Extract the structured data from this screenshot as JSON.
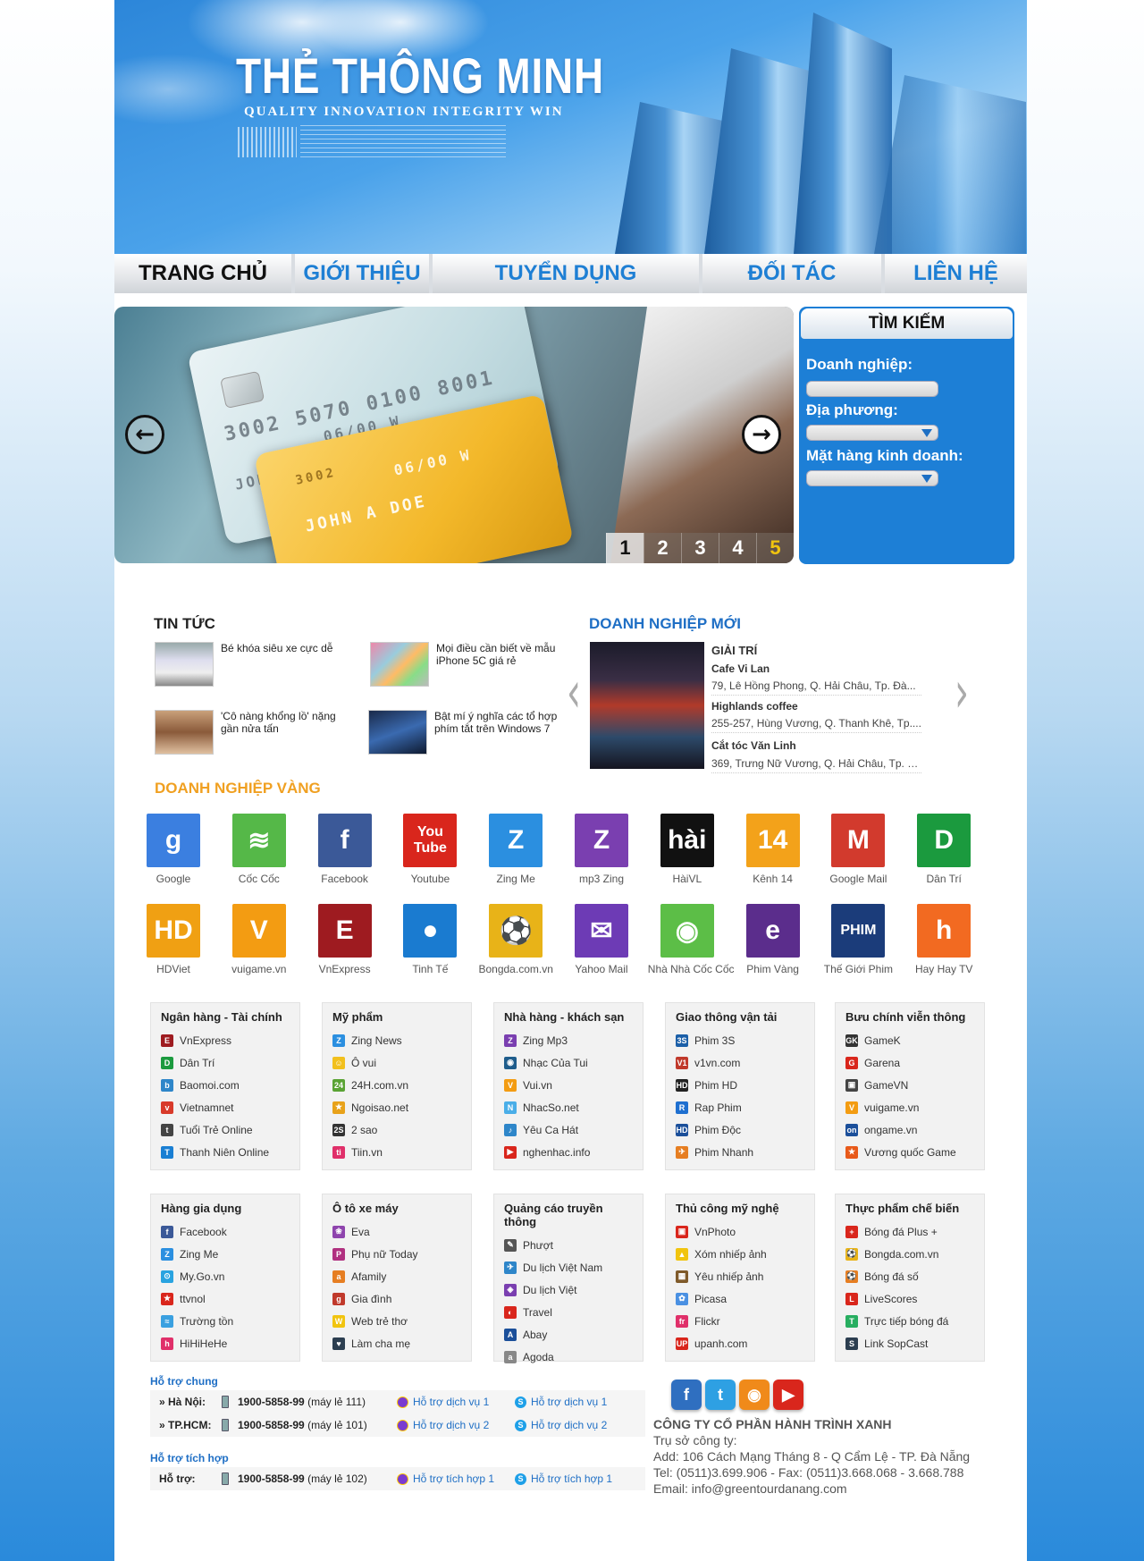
{
  "header": {
    "brand": "THẺ THÔNG MINH",
    "slogan": "QUALITY INNOVATION INTEGRITY WIN"
  },
  "nav": [
    {
      "label": "TRANG CHỦ",
      "active": true
    },
    {
      "label": "GIỚI THIỆU",
      "active": false
    },
    {
      "label": "TUYỂN DỤNG",
      "active": false
    },
    {
      "label": "ĐỐI TÁC",
      "active": false
    },
    {
      "label": "LIÊN HỆ",
      "active": false
    }
  ],
  "slider": {
    "card_number_1": "3002 5070 0100 8001",
    "card_date_1": "06/00 W",
    "card_name_1": "JOHN A DOE",
    "card_number_2": "3002",
    "card_date_2": "06/00 W",
    "card_name_2": "JOHN A DOE",
    "pages": [
      "1",
      "2",
      "3",
      "4",
      "5"
    ],
    "active_page": "1",
    "prev_icon": "arrow-left-icon",
    "next_icon": "arrow-right-icon"
  },
  "search": {
    "title": "TÌM KIẾM",
    "enterprise_label": "Doanh nghiệp:",
    "enterprise_value": "",
    "location_label": "Địa phương:",
    "location_value": "",
    "business_label": "Mặt hàng kinh doanh:",
    "business_value": ""
  },
  "news": {
    "title": "TIN TỨC",
    "items": [
      {
        "text": "Bé khóa siêu xe cực dễ"
      },
      {
        "text": "Mọi điều cần biết về mẫu iPhone 5C giá rẻ"
      },
      {
        "text": "'Cô nàng khổng lồ' nặng gần nửa tấn"
      },
      {
        "text": "Bật mí ý nghĩa các tổ hợp phím tắt trên Windows 7"
      }
    ]
  },
  "new_business": {
    "title": "DOANH NGHIỆP MỚI",
    "category": "GIẢI TRÍ",
    "items": [
      {
        "name": "Cafe Vi Lan",
        "address": "79, Lê Hồng Phong, Q. Hải Châu, Tp. Đà..."
      },
      {
        "name": "Highlands coffee",
        "address": "255-257, Hùng Vương, Q. Thanh Khê, Tp...."
      },
      {
        "name": "Cắt tóc Văn Linh",
        "address": "369, Trưng Nữ Vương, Q. Hải Châu, Tp. Đ..."
      }
    ]
  },
  "gold_business": {
    "title": "DOANH NGHIỆP VÀNG",
    "items": [
      {
        "label": "Google",
        "glyph": "g",
        "color": "#3b7fe0"
      },
      {
        "label": "Cốc Cốc",
        "glyph": "≋",
        "color": "#55b848"
      },
      {
        "label": "Facebook",
        "glyph": "f",
        "color": "#3b5998"
      },
      {
        "label": "Youtube",
        "glyph": "You Tube",
        "color": "#d9261c"
      },
      {
        "label": "Zing Me",
        "glyph": "Z",
        "color": "#2b8fe0"
      },
      {
        "label": "mp3 Zing",
        "glyph": "Z",
        "color": "#7a3fb0"
      },
      {
        "label": "HàiVL",
        "glyph": "hài",
        "color": "#111111"
      },
      {
        "label": "Kênh 14",
        "glyph": "14",
        "color": "#f3a21a"
      },
      {
        "label": "Google Mail",
        "glyph": "M",
        "color": "#d23a2d"
      },
      {
        "label": "Dân Trí",
        "glyph": "D",
        "color": "#1b9a3e"
      },
      {
        "label": "HDViet",
        "glyph": "HD",
        "color": "#f0a013"
      },
      {
        "label": "vuigame.vn",
        "glyph": "V",
        "color": "#f39c12"
      },
      {
        "label": "VnExpress",
        "glyph": "E",
        "color": "#9e1b20"
      },
      {
        "label": "Tinh Tế",
        "glyph": "●",
        "color": "#1a7bd0"
      },
      {
        "label": "Bongda.com.vn",
        "glyph": "⚽",
        "color": "#e8b318"
      },
      {
        "label": "Yahoo Mail",
        "glyph": "✉",
        "color": "#6d3bb5"
      },
      {
        "label": "Nhà Nhà Cốc Cốc",
        "glyph": "◉",
        "color": "#5cbe47"
      },
      {
        "label": "Phim Vàng",
        "glyph": "e",
        "color": "#5b2d8c"
      },
      {
        "label": "Thế Giới Phim",
        "glyph": "PHIM",
        "color": "#1b3c7a"
      },
      {
        "label": "Hay Hay TV",
        "glyph": "h",
        "color": "#f26a21"
      }
    ]
  },
  "categories": [
    {
      "title": "Ngân hàng - Tài chính",
      "links": [
        {
          "label": "VnExpress",
          "color": "#9e1b20",
          "g": "E"
        },
        {
          "label": "Dân Trí",
          "color": "#1b9a3e",
          "g": "D"
        },
        {
          "label": "Baomoi.com",
          "color": "#2e86c9",
          "g": "b"
        },
        {
          "label": "Vietnamnet",
          "color": "#d83a2a",
          "g": "v"
        },
        {
          "label": "Tuổi Trẻ Online",
          "color": "#444444",
          "g": "t"
        },
        {
          "label": "Thanh Niên Online",
          "color": "#1a7fd3",
          "g": "T"
        }
      ]
    },
    {
      "title": "Mỹ phẩm",
      "links": [
        {
          "label": "Zing News",
          "color": "#2b8fe0",
          "g": "Z"
        },
        {
          "label": "Ô vui",
          "color": "#f2c01d",
          "g": "☺"
        },
        {
          "label": "24H.com.vn",
          "color": "#5aa334",
          "g": "24"
        },
        {
          "label": "Ngoisao.net",
          "color": "#e8a21a",
          "g": "★"
        },
        {
          "label": "2 sao",
          "color": "#333333",
          "g": "2S"
        },
        {
          "label": "Tiin.vn",
          "color": "#e0306a",
          "g": "ti"
        }
      ]
    },
    {
      "title": "Nhà hàng - khách sạn",
      "links": [
        {
          "label": "Zing Mp3",
          "color": "#7a3fb0",
          "g": "Z"
        },
        {
          "label": "Nhạc Của Tui",
          "color": "#1f5d8c",
          "g": "◉"
        },
        {
          "label": "Vui.vn",
          "color": "#f39c12",
          "g": "V"
        },
        {
          "label": "NhacSo.net",
          "color": "#4aaee8",
          "g": "N"
        },
        {
          "label": "Yêu Ca Hát",
          "color": "#2e86c9",
          "g": "♪"
        },
        {
          "label": "nghenhac.info",
          "color": "#d9261c",
          "g": "▶"
        }
      ]
    },
    {
      "title": "Giao thông vận tải",
      "links": [
        {
          "label": "Phim 3S",
          "color": "#1b5fa8",
          "g": "3S"
        },
        {
          "label": "v1vn.com",
          "color": "#c0392b",
          "g": "V1"
        },
        {
          "label": "Phim HD",
          "color": "#222222",
          "g": "HD"
        },
        {
          "label": "Rap Phim",
          "color": "#1e6fd0",
          "g": "R"
        },
        {
          "label": "Phim Độc",
          "color": "#1b4f9a",
          "g": "HD"
        },
        {
          "label": "Phim Nhanh",
          "color": "#e67e22",
          "g": "✈"
        }
      ]
    },
    {
      "title": "Bưu chính viễn thông",
      "links": [
        {
          "label": "GameK",
          "color": "#333333",
          "g": "GK"
        },
        {
          "label": "Garena",
          "color": "#d9261c",
          "g": "G"
        },
        {
          "label": "GameVN",
          "color": "#444444",
          "g": "▣"
        },
        {
          "label": "vuigame.vn",
          "color": "#f39c12",
          "g": "V"
        },
        {
          "label": "ongame.vn",
          "color": "#1b4f9a",
          "g": "on"
        },
        {
          "label": "Vương quốc Game",
          "color": "#e85a1a",
          "g": "★"
        }
      ]
    },
    {
      "title": "Hàng gia dụng",
      "links": [
        {
          "label": "Facebook",
          "color": "#3b5998",
          "g": "f"
        },
        {
          "label": "Zing Me",
          "color": "#2b8fe0",
          "g": "Z"
        },
        {
          "label": "My.Go.vn",
          "color": "#29a3e0",
          "g": "⊙"
        },
        {
          "label": "ttvnol",
          "color": "#d9261c",
          "g": "★"
        },
        {
          "label": "Trường tồn",
          "color": "#3aa0e0",
          "g": "≈"
        },
        {
          "label": "HiHiHeHe",
          "color": "#e0306a",
          "g": "h"
        }
      ]
    },
    {
      "title": "Ô tô xe máy",
      "links": [
        {
          "label": "Eva",
          "color": "#8e44ad",
          "g": "❀"
        },
        {
          "label": "Phụ nữ Today",
          "color": "#b03080",
          "g": "P"
        },
        {
          "label": "Afamily",
          "color": "#e67e22",
          "g": "a"
        },
        {
          "label": "Gia đình",
          "color": "#c0392b",
          "g": "g"
        },
        {
          "label": "Web trẻ thơ",
          "color": "#f1c40f",
          "g": "W"
        },
        {
          "label": "Làm cha mẹ",
          "color": "#2c3e50",
          "g": "♥"
        }
      ]
    },
    {
      "title": "Quảng cáo truyền thông",
      "links": [
        {
          "label": "Phượt",
          "color": "#555555",
          "g": "✎"
        },
        {
          "label": "Du lịch Việt Nam",
          "color": "#2e86c9",
          "g": "✈"
        },
        {
          "label": "Du lịch Việt",
          "color": "#7a3fb0",
          "g": "◈"
        },
        {
          "label": "Travel",
          "color": "#d9261c",
          "g": "◐"
        },
        {
          "label": "Abay",
          "color": "#1b4f9a",
          "g": "A"
        },
        {
          "label": "Agoda",
          "color": "#888888",
          "g": "a"
        }
      ]
    },
    {
      "title": "Thủ công mỹ nghệ",
      "links": [
        {
          "label": "VnPhoto",
          "color": "#d9261c",
          "g": "▣"
        },
        {
          "label": "Xóm nhiếp ảnh",
          "color": "#f1c40f",
          "g": "▲"
        },
        {
          "label": "Yêu nhiếp ảnh",
          "color": "#7f5a2a",
          "g": "▦"
        },
        {
          "label": "Picasa",
          "color": "#4a90e2",
          "g": "✿"
        },
        {
          "label": "Flickr",
          "color": "#e0306a",
          "g": "fr"
        },
        {
          "label": "upanh.com",
          "color": "#d9261c",
          "g": "UP"
        }
      ]
    },
    {
      "title": "Thực phẩm chế biến",
      "links": [
        {
          "label": "Bóng đá Plus +",
          "color": "#d9261c",
          "g": "+"
        },
        {
          "label": "Bongda.com.vn",
          "color": "#e8b318",
          "g": "⚽"
        },
        {
          "label": "Bóng đá số",
          "color": "#e67e22",
          "g": "⚽"
        },
        {
          "label": "LiveScores",
          "color": "#d9261c",
          "g": "L"
        },
        {
          "label": "Trực tiếp bóng đá",
          "color": "#27ae60",
          "g": "T"
        },
        {
          "label": "Link SopCast",
          "color": "#2c3e50",
          "g": "S"
        }
      ]
    }
  ],
  "support": {
    "general_title": "Hỗ trợ chung",
    "rows": [
      {
        "label": "» Hà Nội:",
        "phone": "1900-5858-99",
        "ext": "(máy lẻ 111)",
        "yahoo": "Hỗ trợ dịch vụ 1",
        "skype": "Hỗ trợ dịch vụ 1"
      },
      {
        "label": "» TP.HCM:",
        "phone": "1900-5858-99",
        "ext": "(máy lẻ 101)",
        "yahoo": "Hỗ trợ dịch vụ 2",
        "skype": "Hỗ trợ dịch vụ 2"
      }
    ],
    "integrated_title": "Hỗ trợ tích hợp",
    "integrated": {
      "label": "Hỗ trợ:",
      "phone": "1900-5858-99",
      "ext": "(máy lẻ 102)",
      "yahoo": "Hỗ trợ tích hợp 1",
      "skype": "Hỗ trợ tích hợp 1"
    }
  },
  "social": [
    {
      "name": "facebook-icon",
      "glyph": "f",
      "color": "#2f6fc0"
    },
    {
      "name": "twitter-icon",
      "glyph": "t",
      "color": "#2ea0e3"
    },
    {
      "name": "rss-icon",
      "glyph": "◉",
      "color": "#f08a1a"
    },
    {
      "name": "youtube-icon",
      "glyph": "▶",
      "color": "#d9261c"
    }
  ],
  "company": {
    "name": "CÔNG TY CỔ PHẦN HÀNH TRÌNH XANH",
    "hq": "Trụ sở công ty:",
    "address": "Add: 106 Cách Mạng Tháng 8 - Q Cẩm Lệ - TP. Đà Nẵng",
    "tel": "Tel: (0511)3.699.906 - Fax: (0511)3.668.068 - 3.668.788",
    "email": "Email: info@greentourdanang.com"
  }
}
